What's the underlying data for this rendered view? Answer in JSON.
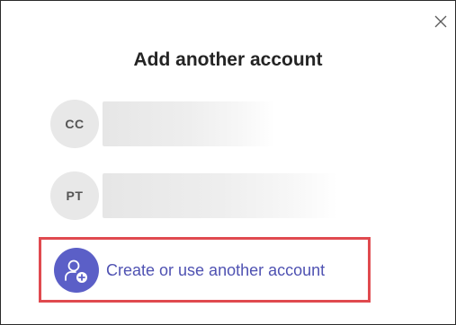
{
  "dialog": {
    "title": "Add another account",
    "close_icon": "close-icon"
  },
  "accounts": [
    {
      "initials": "CC",
      "name_redacted": true
    },
    {
      "initials": "PT",
      "name_redacted": true
    }
  ],
  "create_account": {
    "label": "Create or use another account",
    "icon": "add-person-icon"
  },
  "colors": {
    "accent": "#5b5fc7",
    "link": "#4f52b2",
    "avatar_bg": "#e8e8e8",
    "highlight_border": "#e04a4f"
  }
}
